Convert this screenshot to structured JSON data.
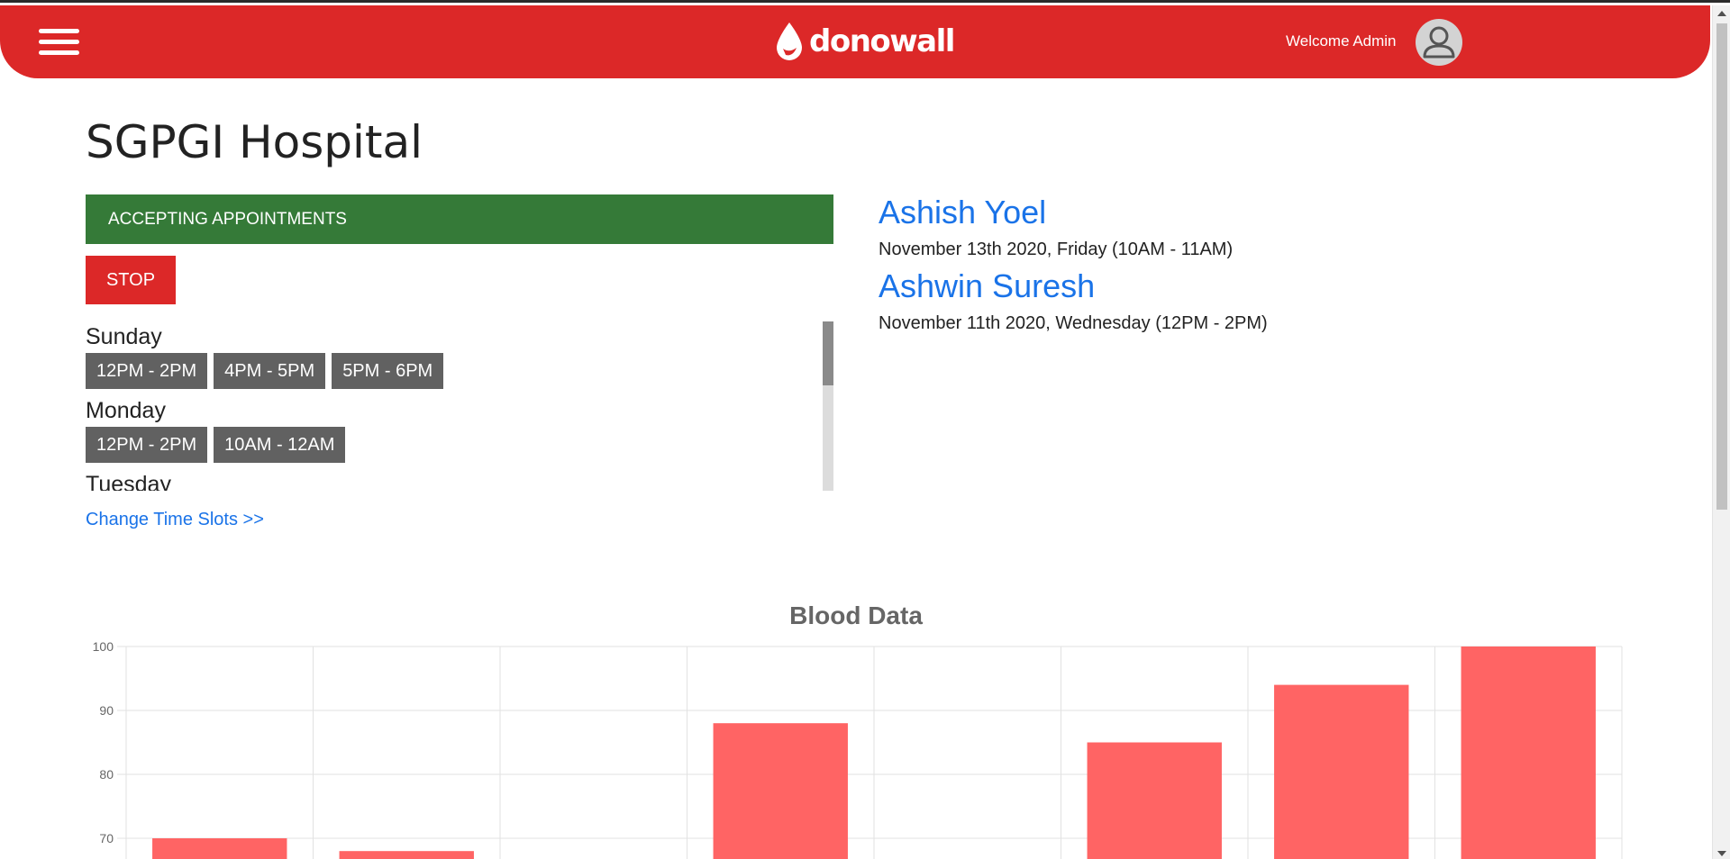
{
  "header": {
    "brand": "donowall",
    "welcome": "Welcome Admin"
  },
  "hospital": {
    "name": "SGPGI Hospital",
    "status": "ACCEPTING APPOINTMENTS",
    "stop_label": "STOP",
    "change_slots_label": "Change Time Slots >>"
  },
  "schedule": {
    "days": [
      {
        "day": "Sunday",
        "slots": [
          "12PM - 2PM",
          "4PM - 5PM",
          "5PM - 6PM"
        ]
      },
      {
        "day": "Monday",
        "slots": [
          "12PM - 2PM",
          "10AM - 12AM"
        ]
      },
      {
        "day": "Tuesday",
        "slots": []
      }
    ]
  },
  "appointments": [
    {
      "name": "Ashish Yoel",
      "time": "November 13th 2020, Friday (10AM - 11AM)"
    },
    {
      "name": "Ashwin Suresh",
      "time": "November 11th 2020, Wednesday (12PM - 2PM)"
    }
  ],
  "colors": {
    "header": "#dc2828",
    "accepting": "#357a38",
    "link": "#1a73e8",
    "slot": "#616161",
    "bar": "#ff6464"
  },
  "chart_data": {
    "type": "bar",
    "title": "Blood Data",
    "categories": [
      "",
      "",
      "",
      "",
      "",
      "",
      "",
      ""
    ],
    "values": [
      70,
      68,
      null,
      88,
      null,
      85,
      94,
      100
    ],
    "ylim": [
      70,
      100
    ],
    "yticks": [
      100,
      90,
      80,
      70
    ],
    "grid": true,
    "bar_color": "#ff6464"
  }
}
